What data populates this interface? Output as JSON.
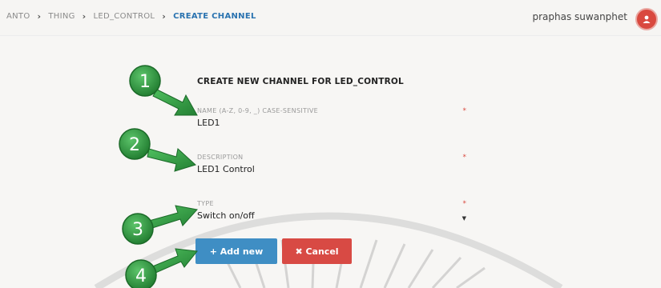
{
  "breadcrumb": {
    "items": [
      "ANTO",
      "THING",
      "LED_CONTROL"
    ],
    "current": "CREATE CHANNEL",
    "separator": "›"
  },
  "user": {
    "name": "praphas suwanphet"
  },
  "form": {
    "title": "CREATE NEW CHANNEL FOR LED_CONTROL",
    "name_field": {
      "label": "NAME (A-Z, 0-9, _) CASE-SENSITIVE",
      "value": "LED1",
      "required_mark": "*"
    },
    "description_field": {
      "label": "DESCRIPTION",
      "value": "LED1 Control",
      "required_mark": "*"
    },
    "type_field": {
      "label": "TYPE",
      "value": "Switch on/off",
      "required_mark": "*"
    },
    "add_button": "+ Add new",
    "cancel_button": "✖ Cancel"
  },
  "callouts": [
    "1",
    "2",
    "3",
    "4"
  ],
  "colors": {
    "accent": "#2a73b0",
    "add_button": "#3f8ec4",
    "cancel_button": "#d84a44",
    "callout_green": "#2e8b3a"
  },
  "icons": [
    "chevron-right-icon",
    "avatar-icon",
    "arrow-icon",
    "plus-icon",
    "close-icon"
  ]
}
